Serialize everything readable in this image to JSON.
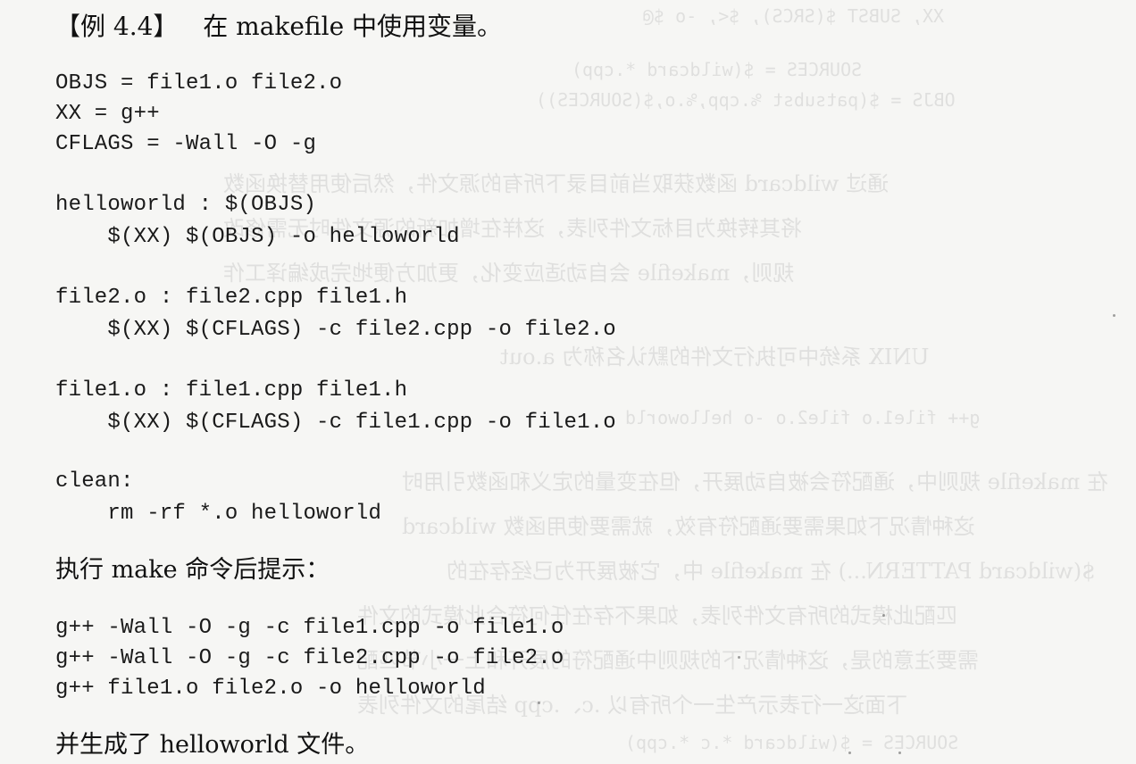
{
  "example_heading": {
    "bracket_label": "【例 4.4】",
    "title": "在 makefile 中使用变量。"
  },
  "makefile_lines": [
    "OBJS = file1.o file2.o",
    "XX = g++",
    "CFLAGS = -Wall -O -g",
    "helloworld : $(OBJS)",
    "    $(XX) $(OBJS) -o helloworld",
    "file2.o : file2.cpp file1.h",
    "    $(XX) $(CFLAGS) -c file2.cpp -o file2.o",
    "file1.o : file1.cpp file1.h",
    "    $(XX) $(CFLAGS) -c file1.cpp -o file1.o",
    "clean:",
    "    rm -rf *.o helloworld"
  ],
  "make_prompt": {
    "text": "执行 make 命令后提示："
  },
  "output_lines": [
    "g++ -Wall -O -g -c file1.cpp -o file1.o",
    "g++ -Wall -O -g -c file2.cpp -o file2.o",
    "g++ file1.o file2.o -o helloworld"
  ],
  "result": {
    "text": "并生成了 helloworld 文件。"
  }
}
